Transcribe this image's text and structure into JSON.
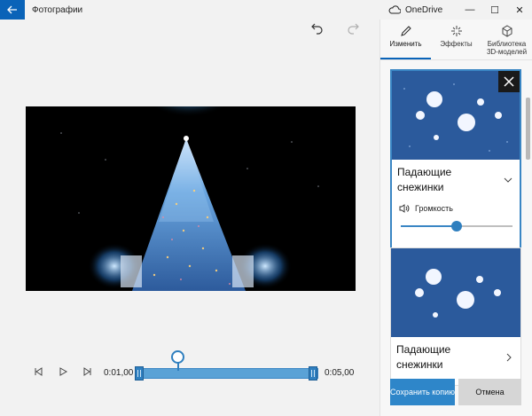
{
  "titlebar": {
    "app_title": "Фотографии",
    "onedrive_label": "OneDrive"
  },
  "timeline": {
    "start_time": "0:01,00",
    "end_time": "0:05,00"
  },
  "panel": {
    "tabs": [
      {
        "label": "Изменить",
        "icon": "pencil-icon",
        "active": true
      },
      {
        "label": "Эффекты",
        "icon": "sparkle-icon",
        "active": false
      },
      {
        "label": "Библиотека 3D-моделей",
        "icon": "cube-icon",
        "active": false
      }
    ],
    "effects": [
      {
        "title": "Падающие снежинки",
        "expanded": true
      },
      {
        "title": "Падающие снежинки",
        "expanded": false
      }
    ],
    "volume_label": "Громкость",
    "volume_level": 0.5
  },
  "actions": {
    "save_label": "Сохранить копию",
    "cancel_label": "Отмена"
  },
  "colors": {
    "accent": "#0a63b8",
    "slider": "#2f7fbf"
  }
}
